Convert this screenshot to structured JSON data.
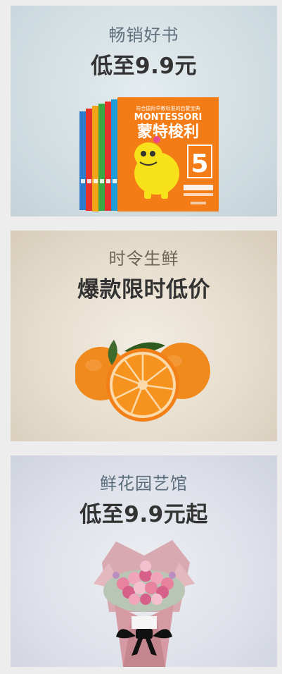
{
  "cards": [
    {
      "subtitle": "畅销好书",
      "headline": "低至9.9元",
      "image": {
        "icon": "book-set-icon",
        "series": "MONTESSORI",
        "title": "蒙特梭利",
        "tagline": "符合国际早教标准的启蒙宝典",
        "number": "5"
      }
    },
    {
      "subtitle": "时令生鲜",
      "headline": "爆款限时低价",
      "image": {
        "icon": "orange-fruit-icon"
      }
    },
    {
      "subtitle": "鲜花园艺馆",
      "headline": "低至9.9元起",
      "image": {
        "icon": "flower-bouquet-icon"
      }
    }
  ]
}
